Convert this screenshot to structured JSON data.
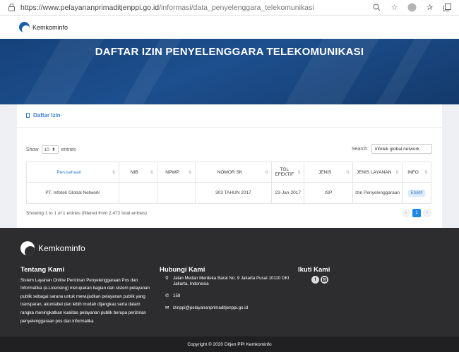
{
  "browser": {
    "url_host": "https://www.pelayananprimaditjenppi.go.id",
    "url_path": "/informasi/data_penyelenggara_telekomunikasi"
  },
  "site": {
    "logo_text": "Kemkominfo"
  },
  "hero": {
    "title": "DAFTAR IZIN PENYELENGGARA TELEKOMUNIKASI"
  },
  "card": {
    "title": "Daftar Izin",
    "show_label": "Show",
    "entries_value": "10",
    "entries_label": "entries",
    "search_label": "Search:",
    "search_value": "infotek global network",
    "columns": [
      "Perusahaan",
      "NIB",
      "NPWP",
      "NOMOR SK",
      "TGL EFEKTIF",
      "JENIS",
      "JENIS LAYANAN",
      "INFO"
    ],
    "rows": [
      {
        "perusahaan": "PT. Infotek Global Network",
        "nib": "",
        "npwp": "",
        "nomor_sk": "303 TAHUN 2017",
        "tgl_efektif": "23-Jan-2017",
        "jenis": "ISP",
        "jenis_layanan": "Izin Penyelenggaraan",
        "info": "Efektif"
      }
    ],
    "showing": "Showing 1 to 1 of 1 entries (filtered from 2,472 total entries)",
    "pager": {
      "prev": "‹",
      "current": "1",
      "next": "›"
    }
  },
  "footer": {
    "logo_text": "Kemkominfo",
    "about_title": "Tentang Kami",
    "about_text": "Sistem Layanan Online Perizinan Penyelenggaraan Pos dan Informatika (e-Licensing) merupakan bagian dari sistem pelayanan publik sebagai sarana untuk mewujudkan pelayanan publik yang transparan, akuntabel dan lebih mudah dijangkau serta dalam rangka meningkatkan kualitas pelayanan publik berupa perizinan penyelenggaraan pos dan informatika",
    "contact_title": "Hubungi Kami",
    "address": "Jalan Medan Merdeka Barat No. 9 Jakarta Pusat 10110 DKI Jakarta, Indonesia",
    "phone": "159",
    "email": "izinppi@pelayananprimaditjenppi.go.id",
    "follow_title": "Ikuti Kami",
    "copyright": "Copyright © 2020 Ditjen PPI Kemkominfo"
  },
  "colors": {
    "accent": "#3b7fd4",
    "hero": "#1d4f8e",
    "footer": "#2d2d2f"
  }
}
